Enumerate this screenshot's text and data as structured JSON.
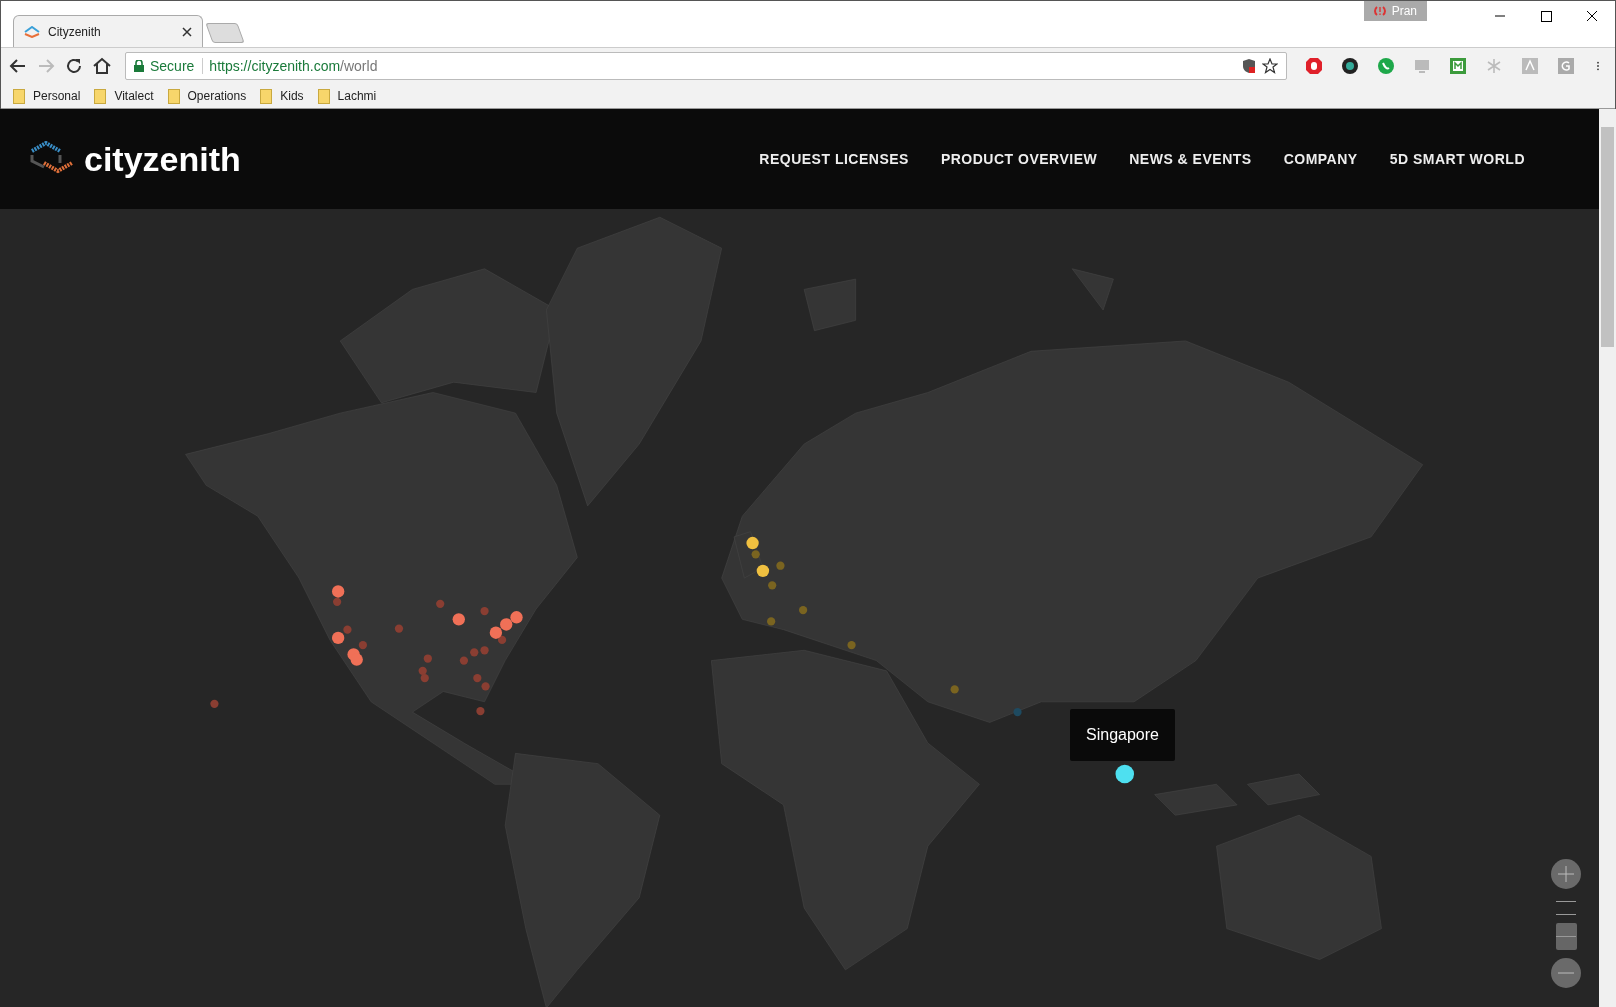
{
  "browser": {
    "tab": {
      "title": "Cityzenith",
      "selected": true
    },
    "profile": "Pran",
    "security": "Secure",
    "url": {
      "host": "https://cityzenith.com",
      "path": "/world"
    },
    "bookmarks": [
      "Personal",
      "Vitalect",
      "Operations",
      "Kids",
      "Lachmi"
    ]
  },
  "site": {
    "logo": "cityzenith",
    "nav": [
      "REQUEST LICENSES",
      "PRODUCT OVERVIEW",
      "NEWS & EVENTS",
      "COMPANY",
      "5D SMART WORLD"
    ],
    "map": {
      "tooltip": "Singapore"
    }
  }
}
